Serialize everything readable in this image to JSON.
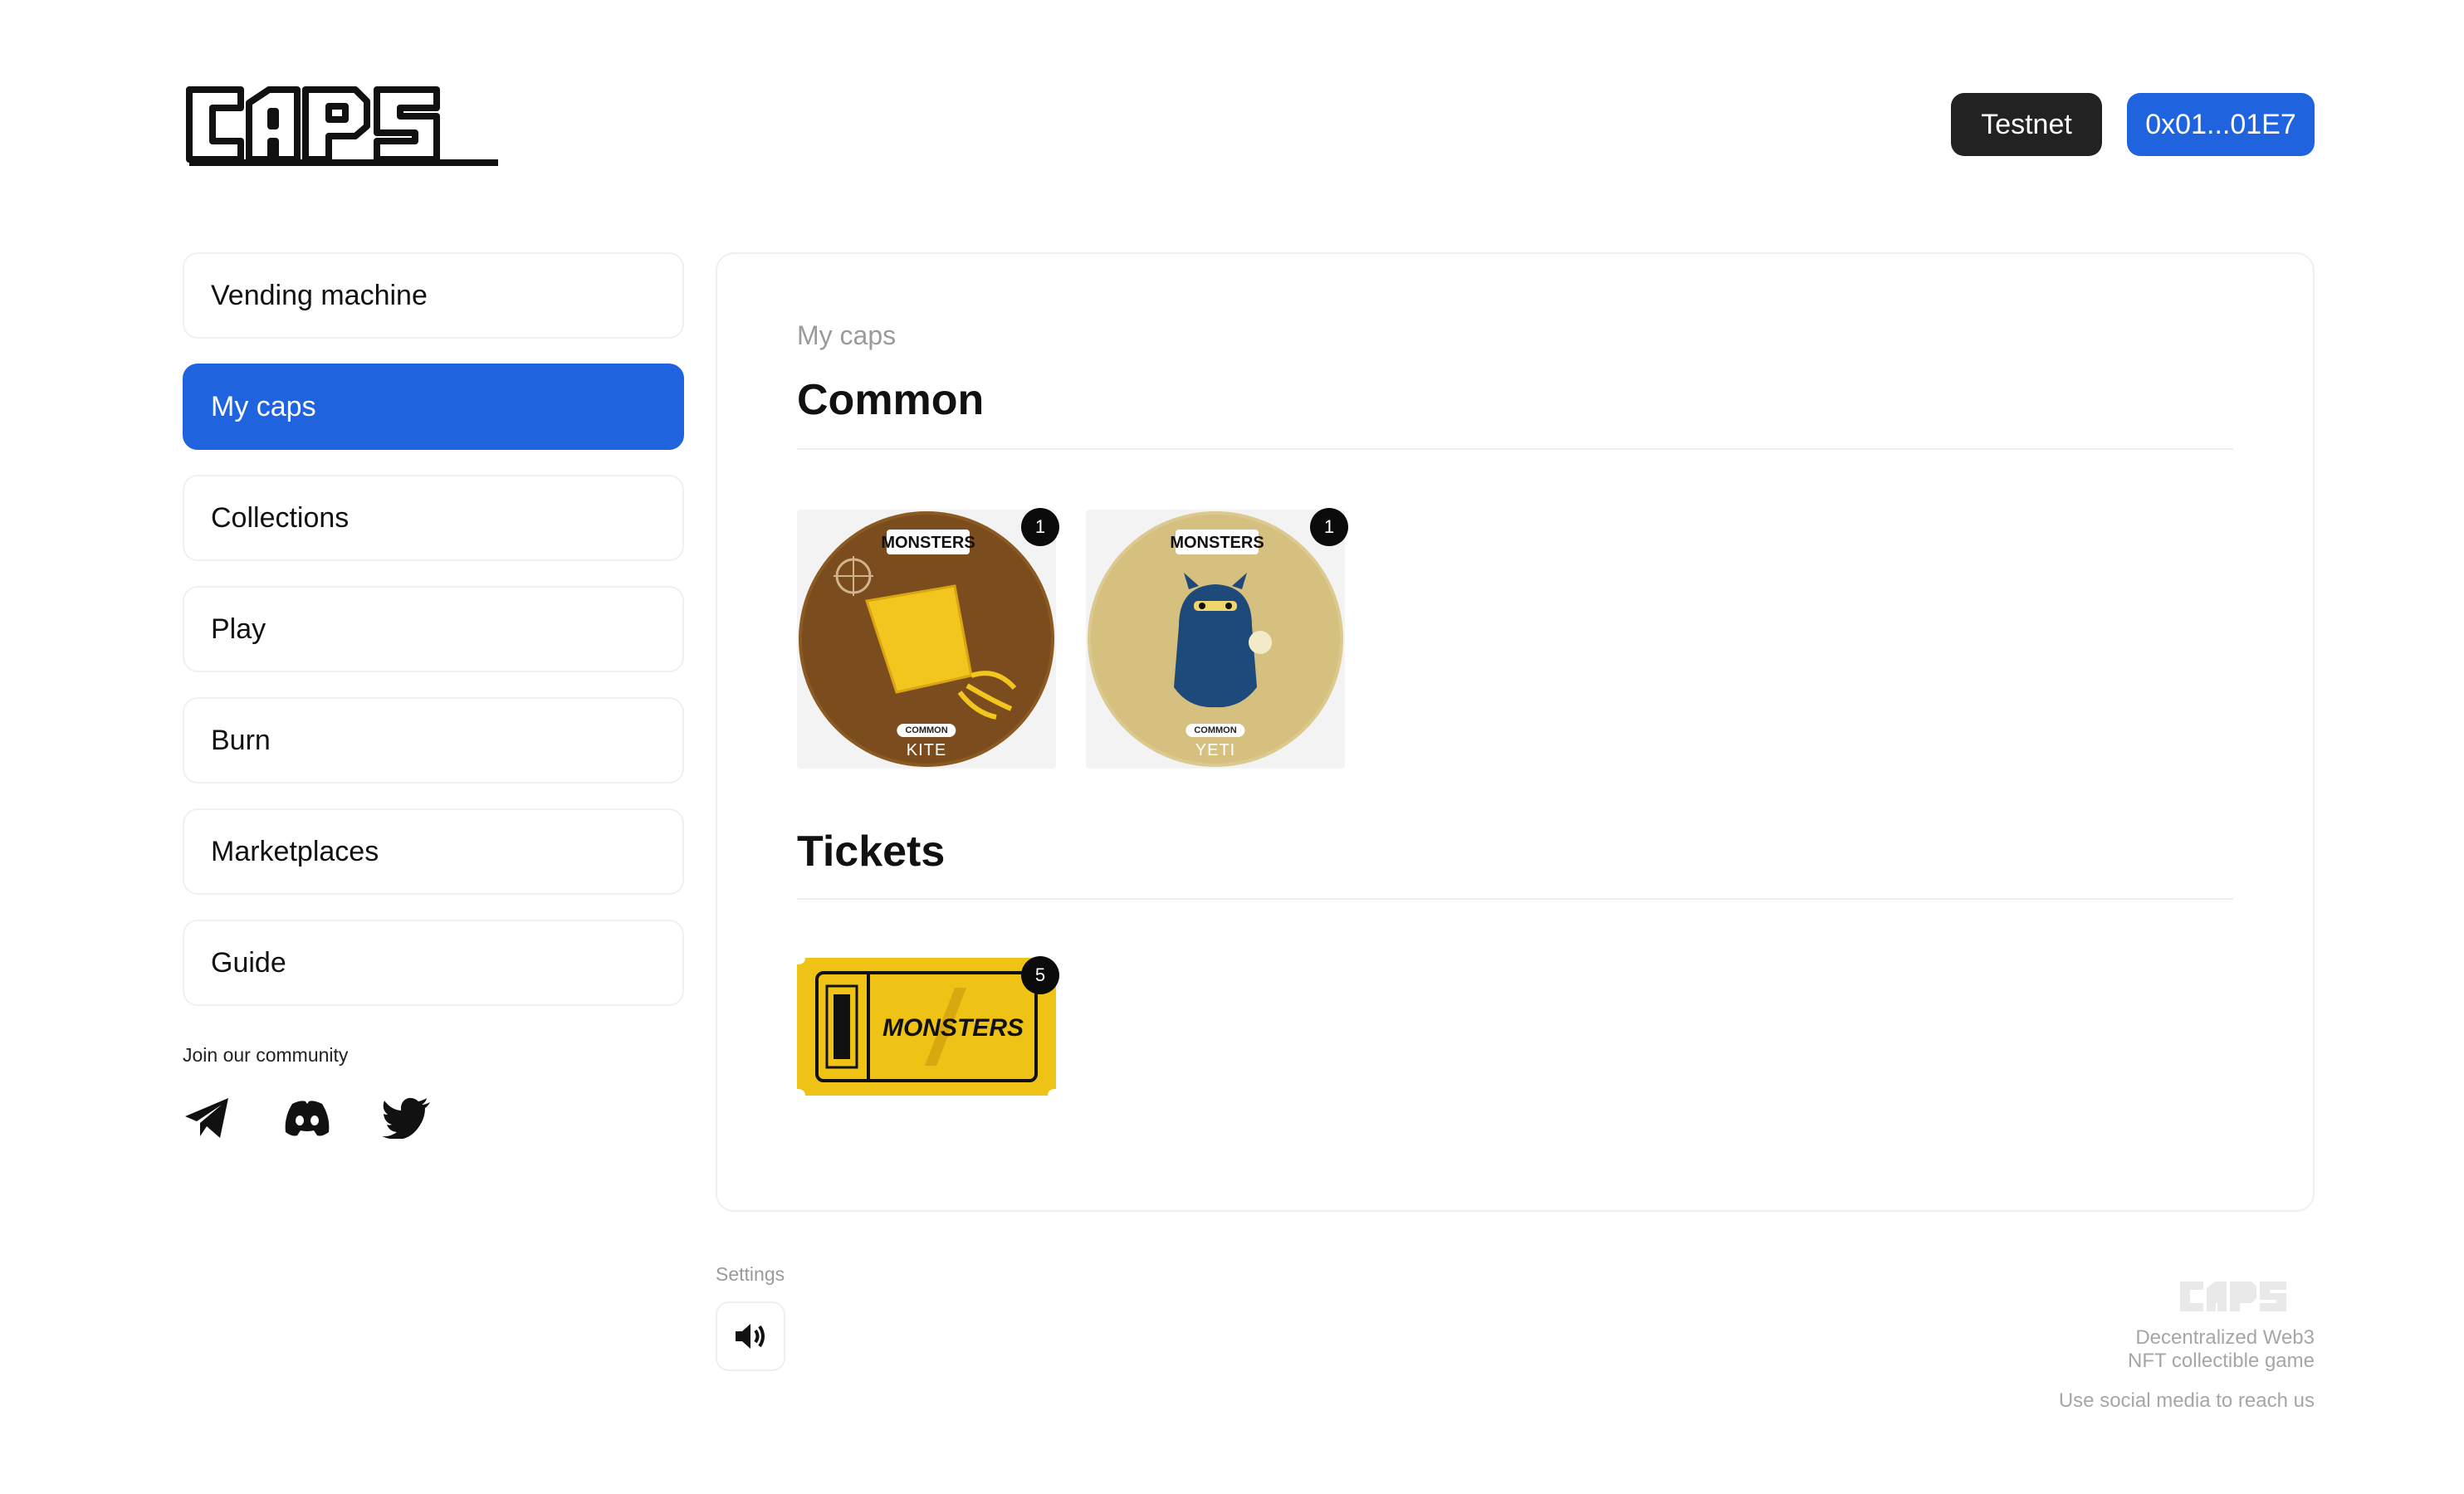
{
  "brand": {
    "logo_text": "Caps"
  },
  "header": {
    "network_label": "Testnet",
    "wallet_label": "0x01...01E7"
  },
  "sidebar": {
    "items": [
      {
        "label": "Vending machine"
      },
      {
        "label": "My caps",
        "active": true
      },
      {
        "label": "Collections"
      },
      {
        "label": "Play"
      },
      {
        "label": "Burn"
      },
      {
        "label": "Marketplaces"
      },
      {
        "label": "Guide"
      }
    ],
    "community_label": "Join our community",
    "socials": [
      "telegram-icon",
      "discord-icon",
      "twitter-icon"
    ]
  },
  "main": {
    "breadcrumb": "My caps",
    "sections": [
      {
        "title": "Common",
        "items": [
          {
            "name": "KITE",
            "rarity": "COMMON",
            "collection": "MONSTERS",
            "count": "1"
          },
          {
            "name": "YETI",
            "rarity": "COMMON",
            "collection": "MONSTERS",
            "count": "1"
          }
        ]
      },
      {
        "title": "Tickets",
        "items": [
          {
            "name": "MONSTERS",
            "count": "5"
          }
        ]
      }
    ]
  },
  "footer": {
    "settings_label": "Settings",
    "tagline_1": "Decentralized Web3",
    "tagline_2": "NFT collectible game",
    "reach": "Use social media to reach us"
  },
  "colors": {
    "accent": "#1f63df",
    "dark": "#222222",
    "ticket": "#f2c316"
  }
}
